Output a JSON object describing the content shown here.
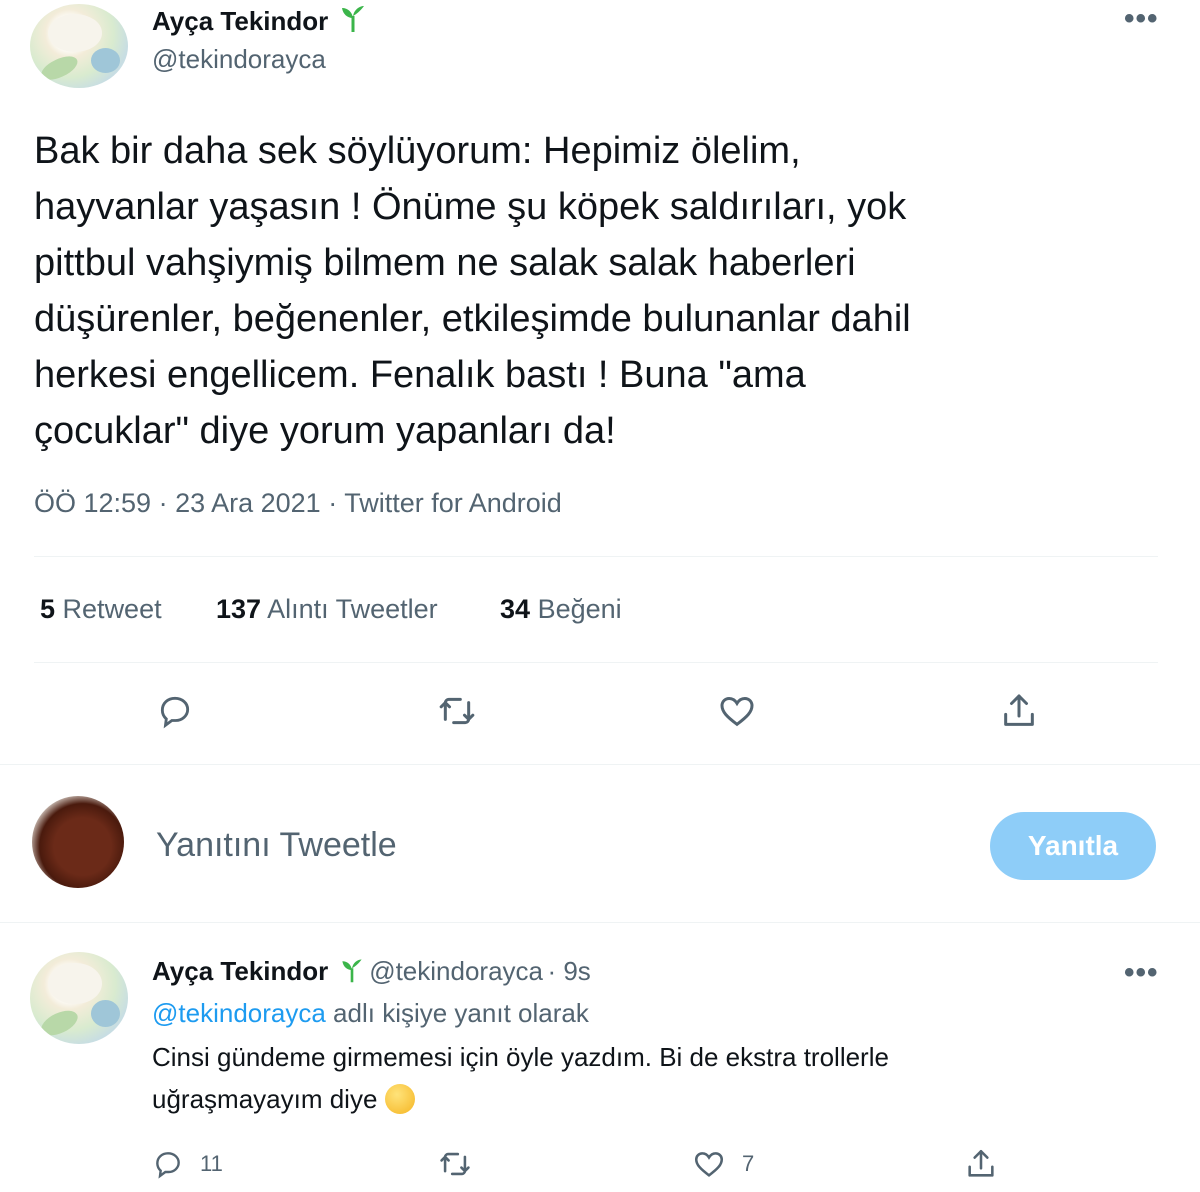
{
  "tweet": {
    "author_name": "Ayça Tekindor",
    "author_handle": "@tekindorayca",
    "text": "Bak bir daha sek söylüyorum: Hepimiz ölelim,\nhayvanlar yaşasın ! Önüme şu köpek saldırıları, yok\npittbul vahşiymiş bilmem ne salak salak haberleri\ndüşürenler, beğenenler, etkileşimde bulunanlar dahil\nherkesi engellicem. Fenalık bastı ! Buna \"ama\nçocuklar\" diye yorum yapanları da!",
    "meta": "ÖÖ 12:59 · 23 Ara 2021 · Twitter for Android",
    "stats": {
      "retweets_count": "5",
      "retweets_label": "Retweet",
      "quotes_count": "137",
      "quotes_label": "Alıntı Tweetler",
      "likes_count": "34",
      "likes_label": "Beğeni"
    },
    "icons": [
      "reply-icon",
      "retweet-icon",
      "like-icon",
      "share-icon"
    ]
  },
  "composer": {
    "placeholder": "Yanıtını Tweetle",
    "button_label": "Yanıtla"
  },
  "reply": {
    "author_name": "Ayça Tekindor",
    "author_handle": "@tekindorayca",
    "time": "· 9s",
    "replying_to_handle": "@tekindorayca",
    "replying_to_suffix": "adlı kişiye yanıt olarak",
    "text_line1": "Cinsi gündeme girmemesi için öyle yazdım. Bi de ekstra trollerle",
    "text_line2": "uğraşmayayım diye",
    "reply_count": "11",
    "like_count": "7"
  },
  "colors": {
    "accent": "#1d9bf0",
    "button_disabled": "#8ecdf8",
    "secondary_text": "#536471",
    "verified_sprout": "#3bb54a"
  }
}
